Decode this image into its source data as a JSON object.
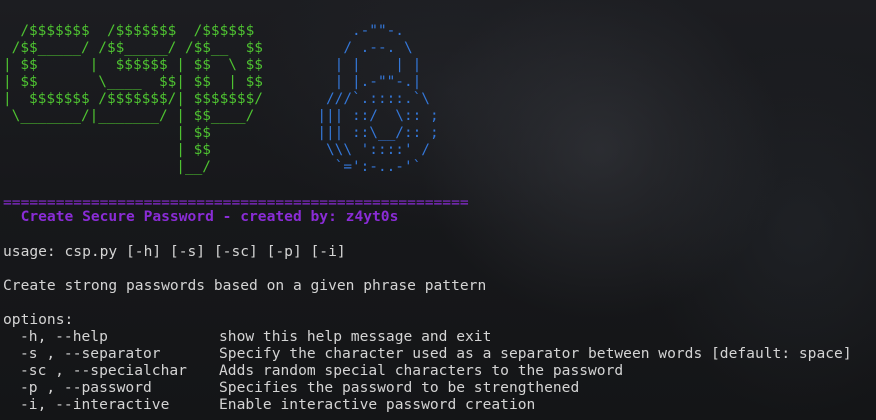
{
  "ascii_art": {
    "letters": "  /$$$$$$$  /$$$$$$$  /$$$$$$\n /$$_____/ /$$_____/ /$$__  $$\n| $$      |  $$$$$$ | $$  \\ $$\n| $$       \\____  $$| $$  | $$\n|  $$$$$$$ /$$$$$$$/| $$$$$$$/\n \\_______/|_______/ | $$____/\n                    | $$\n                    | $$\n                    |__/",
    "lock": "      .-\"\"-.\n     / .--. \\\n    | |    | |\n    | |.-\"\"-.|\n   ///`.::::.`\\\n  ||| ::/  \\:: ;\n  ||| ::\\__/:: ;\n   \\\\\\ '::::' /\n    `=':-..-'`",
    "letters_color": "#4ec231",
    "lock_color": "#3477d8"
  },
  "banner": {
    "rule": "=====================================================",
    "title": "  Create Secure Password - created by: z4yt0s",
    "color": "#8a2cd6"
  },
  "usage": "usage: csp.py [-h] [-s] [-sc] [-p] [-i]",
  "description": "Create strong passwords based on a given phrase pattern",
  "options_heading": "options:",
  "options": [
    {
      "flag": "-h, --help",
      "desc": "show this help message and exit"
    },
    {
      "flag": "-s , --separator",
      "desc": "Specify the character used as a separator between words [default: space]"
    },
    {
      "flag": "-sc , --specialchar",
      "desc": "Adds random special characters to the password"
    },
    {
      "flag": "-p , --password",
      "desc": "Specifies the password to be strengthened"
    },
    {
      "flag": "-i, --interactive",
      "desc": "Enable interactive password creation"
    }
  ]
}
